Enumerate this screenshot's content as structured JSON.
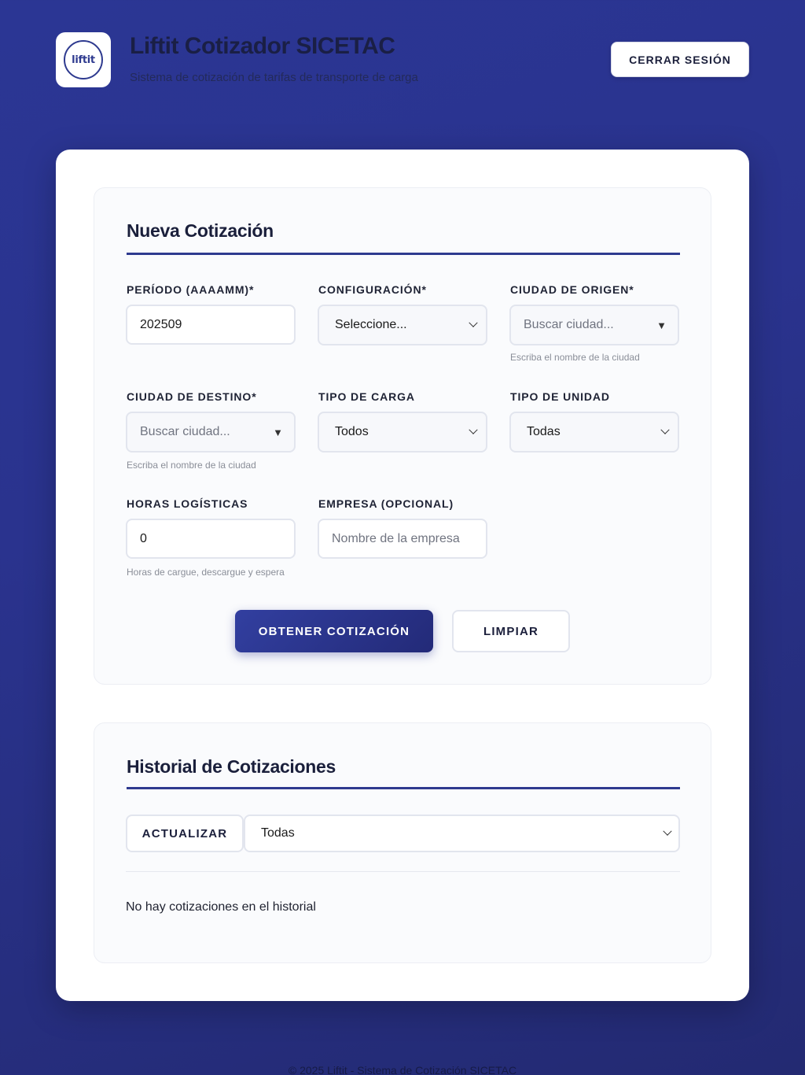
{
  "header": {
    "logo_text": "liftit",
    "title": "Liftit Cotizador SICETAC",
    "subtitle": "Sistema de cotización de tarifas de transporte de carga",
    "logout_label": "CERRAR SESIÓN"
  },
  "form": {
    "title": "Nueva Cotización",
    "periodo": {
      "label": "PERÍODO (AAAAMM)*",
      "value": "202509"
    },
    "configuracion": {
      "label": "CONFIGURACIÓN*",
      "value": "Seleccione..."
    },
    "origen": {
      "label": "CIUDAD DE ORIGEN*",
      "placeholder": "Buscar ciudad...",
      "hint": "Escriba el nombre de la ciudad"
    },
    "destino": {
      "label": "CIUDAD DE DESTINO*",
      "placeholder": "Buscar ciudad...",
      "hint": "Escriba el nombre de la ciudad"
    },
    "tipo_carga": {
      "label": "TIPO DE CARGA",
      "value": "Todos"
    },
    "tipo_unidad": {
      "label": "TIPO DE UNIDAD",
      "value": "Todas"
    },
    "horas": {
      "label": "HORAS LOGÍSTICAS",
      "value": "0",
      "hint": "Horas de cargue, descargue y espera"
    },
    "empresa": {
      "label": "EMPRESA (OPCIONAL)",
      "placeholder": "Nombre de la empresa"
    },
    "submit_label": "OBTENER COTIZACIÓN",
    "clear_label": "LIMPIAR"
  },
  "history": {
    "title": "Historial de Cotizaciones",
    "refresh_label": "ACTUALIZAR",
    "filter_value": "Todas",
    "empty_message": "No hay cotizaciones en el historial"
  },
  "footer": {
    "text": "© 2025 Liftit - Sistema de Cotización SICETAC"
  },
  "colors": {
    "background": "#2a338e",
    "accent": "#2e3a8f",
    "primary_button": "#2a3388"
  }
}
